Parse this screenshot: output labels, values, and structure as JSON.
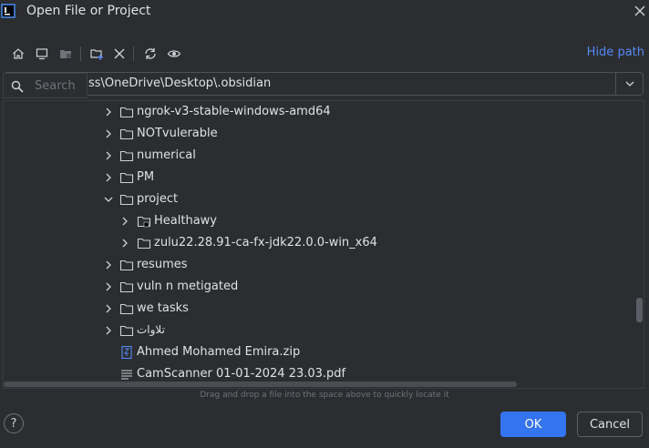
{
  "window": {
    "title": "Open File or Project",
    "app_icon": "intellij-icon"
  },
  "toolbar": {
    "icons": [
      "home-icon",
      "desktop-icon",
      "project-folder-icon",
      "new-folder-icon",
      "delete-icon",
      "refresh-icon",
      "show-hidden-icon"
    ],
    "hide_path_label": "Hide path"
  },
  "path": {
    "value": "ss\\OneDrive\\Desktop\\.obsidian"
  },
  "search": {
    "placeholder": "Search"
  },
  "tree": {
    "items": [
      {
        "label": "ngrok-v3-stable-windows-amd64",
        "type": "folder",
        "expanded": false
      },
      {
        "label": "NOTvulerable",
        "type": "folder",
        "expanded": false
      },
      {
        "label": "numerical",
        "type": "folder",
        "expanded": false
      },
      {
        "label": "PM",
        "type": "folder",
        "expanded": false
      },
      {
        "label": "project",
        "type": "folder",
        "expanded": true
      },
      {
        "label": "Healthawy",
        "type": "module-folder",
        "expanded": false
      },
      {
        "label": "zulu22.28.91-ca-fx-jdk22.0.0-win_x64",
        "type": "folder",
        "expanded": false
      },
      {
        "label": "resumes",
        "type": "folder",
        "expanded": false
      },
      {
        "label": "vuln n metigated",
        "type": "folder",
        "expanded": false
      },
      {
        "label": "we tasks",
        "type": "folder",
        "expanded": false
      },
      {
        "label": "تلاوات",
        "type": "folder",
        "expanded": false
      },
      {
        "label": "Ahmed Mohamed Emira.zip",
        "type": "zip"
      },
      {
        "label": "CamScanner 01-01-2024 23.03.pdf",
        "type": "text"
      }
    ]
  },
  "hint": "Drag and drop a file into the space above to quickly locate it",
  "footer": {
    "help_label": "?",
    "ok_label": "OK",
    "cancel_label": "Cancel"
  },
  "colors": {
    "background": "#2b2d30",
    "accent": "#3574f0",
    "link": "#548af7"
  }
}
